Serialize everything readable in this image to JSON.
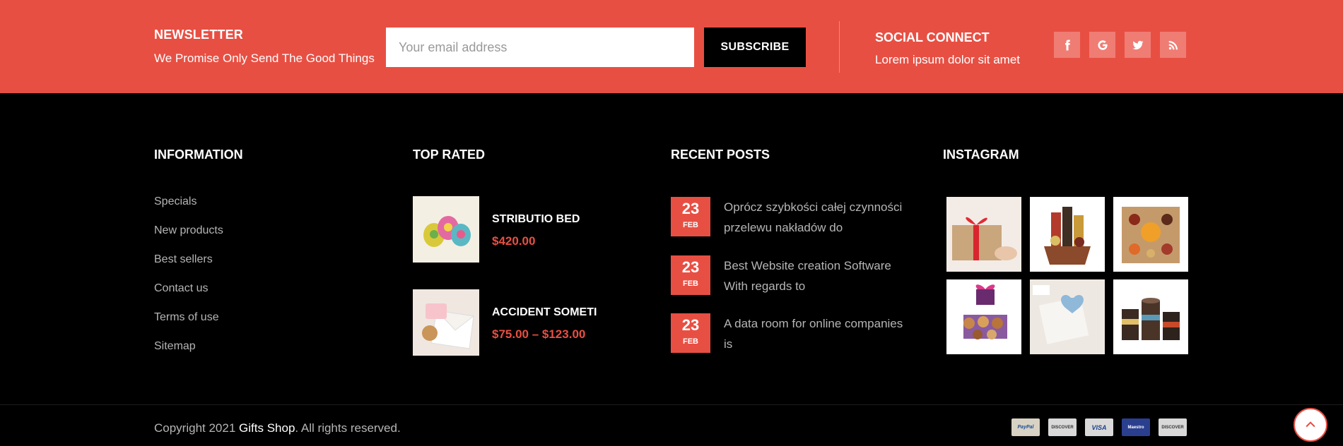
{
  "newsletter": {
    "title": "NEWSLETTER",
    "subtitle": "We Promise Only Send The Good Things",
    "email_placeholder": "Your email address",
    "subscribe_label": "SUBSCRIBE"
  },
  "social": {
    "title": "SOCIAL CONNECT",
    "subtitle": "Lorem ipsum dolor sit amet",
    "icons": [
      "facebook-icon",
      "google-icon",
      "twitter-icon",
      "rss-icon"
    ]
  },
  "information": {
    "title": "INFORMATION",
    "links": [
      "Specials",
      "New products",
      "Best sellers",
      "Contact us",
      "Terms of use",
      "Sitemap"
    ]
  },
  "top_rated": {
    "title": "TOP RATED",
    "products": [
      {
        "name": "STRIBUTIO BED",
        "price": "$420.00"
      },
      {
        "name": "ACCIDENT SOMETI",
        "price": "$75.00 – $123.00"
      }
    ]
  },
  "recent_posts": {
    "title": "RECENT POSTS",
    "posts": [
      {
        "day": "23",
        "month": "FEB",
        "title": "Oprócz szybkości całej czynności przelewu nakładów do"
      },
      {
        "day": "23",
        "month": "FEB",
        "title": "Best Website creation Software With regards to"
      },
      {
        "day": "23",
        "month": "FEB",
        "title": "A data room for online companies is"
      }
    ]
  },
  "instagram": {
    "title": "INSTAGRAM"
  },
  "footer": {
    "copyright_prefix": "Copyright 2021 ",
    "brand": "Gifts Shop",
    "copyright_suffix": ". All rights reserved.",
    "payments": [
      "PayPal",
      "DISCOVER",
      "VISA",
      "Maestro",
      "DISCOVER"
    ]
  },
  "colors": {
    "accent": "#e84f43",
    "background": "#000000",
    "muted_text": "#b5b5b5"
  }
}
